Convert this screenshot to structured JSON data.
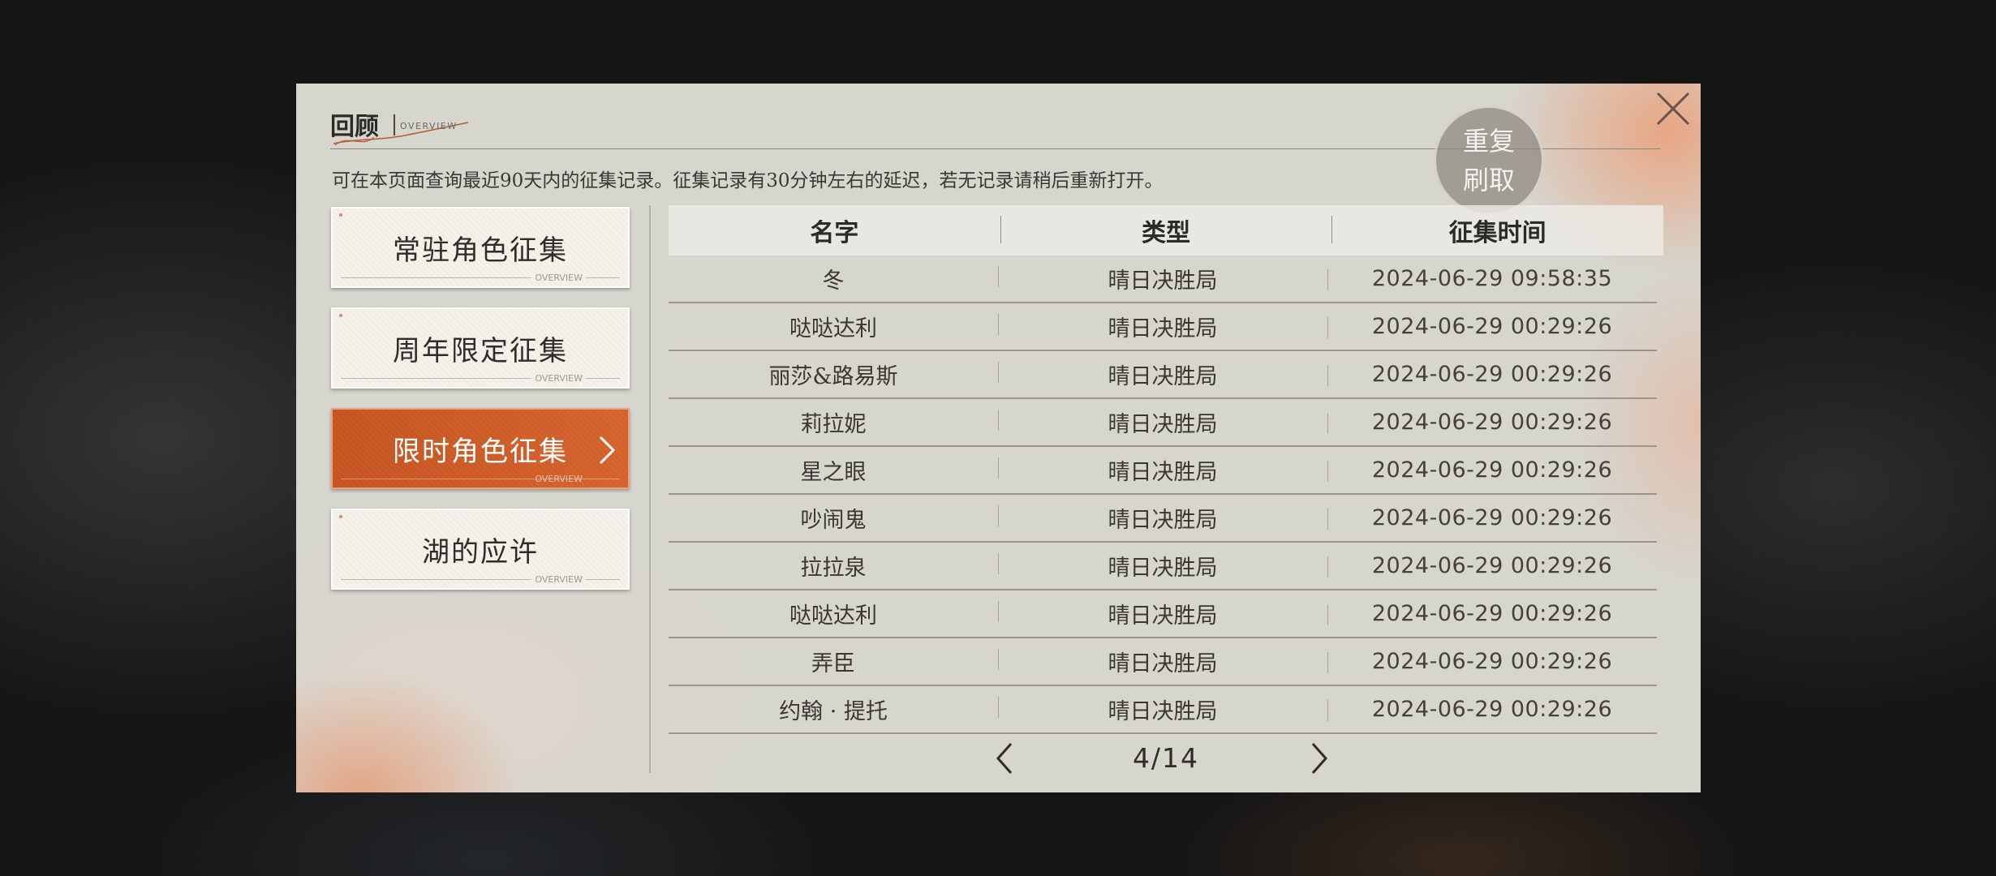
{
  "header": {
    "title": "回顾",
    "subtitle": "OVERVIEW"
  },
  "notice": "可在本页面查询最近90天内的征集记录。征集记录有30分钟左右的延迟，若无记录请稍后重新打开。",
  "refresh_button": {
    "line1": "重复",
    "line2": "刷取"
  },
  "nav": {
    "items": [
      {
        "label": "常驻角色征集",
        "deco": "OVERVIEW",
        "active": false
      },
      {
        "label": "周年限定征集",
        "deco": "OVERVIEW",
        "active": false
      },
      {
        "label": "限时角色征集",
        "deco": "OVERVIEW",
        "active": true
      },
      {
        "label": "湖的应许",
        "deco": "OVERVIEW",
        "active": false
      }
    ]
  },
  "table": {
    "columns": [
      "名字",
      "类型",
      "征集时间"
    ],
    "rows": [
      {
        "name": "冬",
        "type": "晴日决胜局",
        "time": "2024-06-29 09:58:35"
      },
      {
        "name": "哒哒达利",
        "type": "晴日决胜局",
        "time": "2024-06-29 00:29:26"
      },
      {
        "name": "丽莎&路易斯",
        "type": "晴日决胜局",
        "time": "2024-06-29 00:29:26"
      },
      {
        "name": "莉拉妮",
        "type": "晴日决胜局",
        "time": "2024-06-29 00:29:26"
      },
      {
        "name": "星之眼",
        "type": "晴日决胜局",
        "time": "2024-06-29 00:29:26"
      },
      {
        "name": "吵闹鬼",
        "type": "晴日决胜局",
        "time": "2024-06-29 00:29:26"
      },
      {
        "name": "拉拉泉",
        "type": "晴日决胜局",
        "time": "2024-06-29 00:29:26"
      },
      {
        "name": "哒哒达利",
        "type": "晴日决胜局",
        "time": "2024-06-29 00:29:26"
      },
      {
        "name": "弄臣",
        "type": "晴日决胜局",
        "time": "2024-06-29 00:29:26"
      },
      {
        "name": "约翰 · 提托",
        "type": "晴日决胜局",
        "time": "2024-06-29 00:29:26"
      }
    ]
  },
  "pager": {
    "current": "4/14"
  },
  "colors": {
    "accent": "#c9561f",
    "panel": "#d6d5ce",
    "text": "#2c2a27"
  },
  "icons": [
    "close-icon",
    "chevron-left-icon",
    "chevron-right-icon",
    "swoosh-decoration"
  ]
}
